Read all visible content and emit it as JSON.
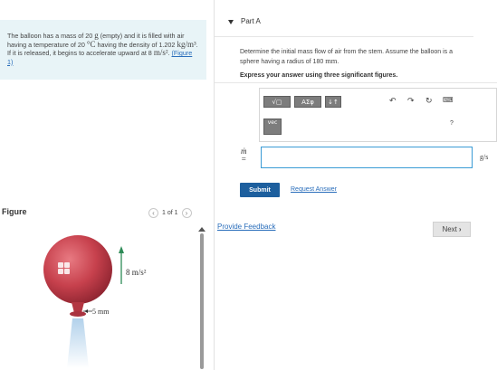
{
  "problem": {
    "text_1": "The balloon has a mass of 20 ",
    "mass_unit": "g",
    "text_2": " (empty) and it is filled with air having a temperature of 20 ",
    "temp_unit": "°C",
    "text_3": " having the density of 1.202 ",
    "density_unit": "kg/m³",
    "text_4": ". If it is released, it begins to accelerate upward at 8 ",
    "accel_unit": "m/s²",
    "text_5": ". ",
    "figure_link": "(Figure 1)"
  },
  "figure": {
    "title": "Figure",
    "pager_text": "1 of 1",
    "acceleration_label": "8 m/s²",
    "stem_label": "5 mm"
  },
  "part": {
    "label": "Part A",
    "question_1": "Determine the initial mass flow of air from the stem. Assume the balloon is a sphere having a radius of 180 ",
    "question_unit": "mm",
    "question_2": ".",
    "instruction": "Express your answer using three significant figures."
  },
  "toolbar": {
    "templates_label": "√▢",
    "greek_label": "ΑΣφ",
    "arrows_label": "↓↑",
    "vec_label": "vec",
    "help_label": "?"
  },
  "answer": {
    "variable": "ṁ",
    "equals": "=",
    "value": "",
    "unit": "g/s"
  },
  "actions": {
    "submit": "Submit",
    "request_answer": "Request Answer",
    "feedback": "Provide Feedback",
    "next": "Next"
  },
  "colors": {
    "problem_bg": "#e8f4f7",
    "link": "#2a6ebb",
    "submit_bg": "#1d5f9e",
    "balloon": "#c7414d"
  }
}
